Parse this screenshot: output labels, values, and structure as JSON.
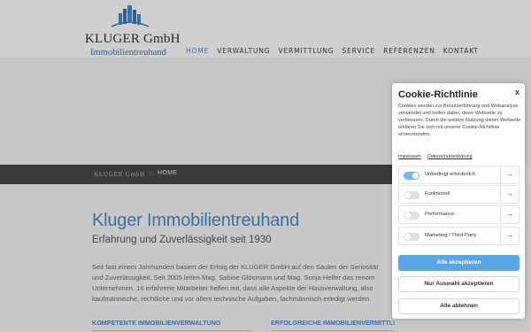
{
  "header": {
    "logo_name": "KLUGER GmbH",
    "logo_subtitle": "Immobilientreuhand",
    "nav": [
      {
        "label": "HOME",
        "active": true
      },
      {
        "label": "VERWALTUNG",
        "active": false
      },
      {
        "label": "VERMITTLUNG",
        "active": false
      },
      {
        "label": "SERVICE",
        "active": false
      },
      {
        "label": "REFERENZEN",
        "active": false
      },
      {
        "label": "KONTAKT",
        "active": false
      }
    ]
  },
  "breadcrumb": {
    "site": "KLUGER GmbH",
    "current": "HOME"
  },
  "main": {
    "title": "Kluger Immobilientreuhand",
    "subtitle": "Erfahrung und Zuverlässigkeit seit 1930",
    "paragraph_lines": [
      "Seit fast einem Jahrhundert basiert der Erfolg der KLUGER GmbH auf den Säulen der Seriosität",
      "und Zuverlässigkeit. Seit 2005 leiten Mag. Sabine Glösmann und Mag. Sonja Helfer das renom",
      "Unternehmen. 16 erfahrene Mitarbeiter helfen mit, dass alle Aspekte der Hausverwaltung, also",
      "kaufmännische, rechtliche und vor allem technische Aufgaben, fachmännisch erledigt werden."
    ],
    "section_left": "KOMPETENTE IMMOBILIENVERWALTUNG",
    "section_right": "ERFOLGREICHE IMMOBILIENVERMITTLUNG"
  },
  "cookie": {
    "title": "Cookie-Richtlinie",
    "close": "x",
    "text": "Cookies werden zur Benutzerführung und Webanalyse verwendet und helfen dabei, diese Webseite zu verbessern. Durch die weitere Nutzung dieser Webseite erklären Sie sich mit unserer Cookie-Richtlinie einverstanden.",
    "link_impressum": "Impressum",
    "link_privacy": "Datenschutzerklärung",
    "categories": [
      {
        "label": "Unbedingt erforderlich",
        "on": true
      },
      {
        "label": "Funktionell",
        "on": false
      },
      {
        "label": "Performance",
        "on": false
      },
      {
        "label": "Marketing / Third Party",
        "on": false
      }
    ],
    "arrow": "→",
    "accept_all": "Alle akzeptieren",
    "accept_selection": "Nur Auswahl akzeptieren",
    "reject_all": "Alle ablehnen"
  },
  "colors": {
    "accent": "#3c6ea6",
    "button_primary": "#56a7e6",
    "toggle_on": "#7ab6e3"
  }
}
